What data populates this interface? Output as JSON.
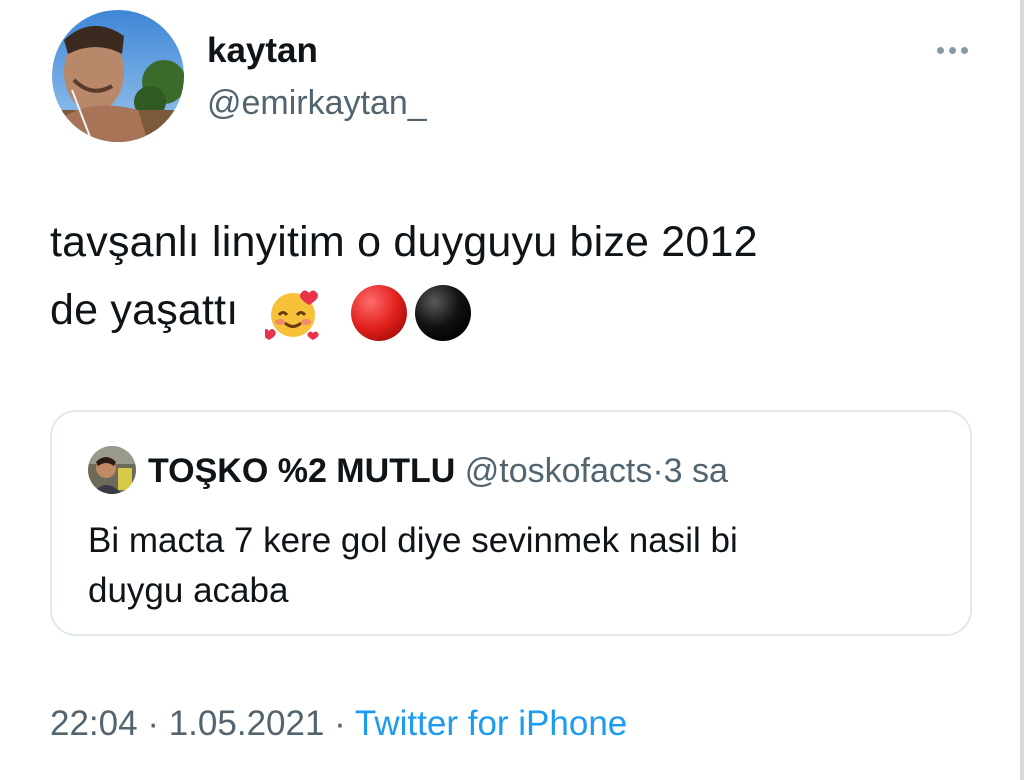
{
  "author": {
    "display_name": "kaytan",
    "username": "@emirkaytan_"
  },
  "tweet": {
    "text_line1": "tavşanlı linyitim o duyguyu bize 2012",
    "text_line2": "de yaşattı",
    "emojis": [
      "smiling-face-with-hearts",
      "red-circle",
      "black-circle"
    ]
  },
  "quoted_tweet": {
    "display_name": "TOŞKO %2 MUTLU",
    "username": "@toskofacts",
    "separator": "·",
    "time": "3 sa",
    "text_line1": "Bi macta 7 kere gol diye sevinmek nasil bi",
    "text_line2": "duygu acaba"
  },
  "meta": {
    "time": "22:04",
    "separator": "·",
    "date": "1.05.2021",
    "separator2": "·",
    "source": "Twitter for iPhone"
  },
  "colors": {
    "text": "#0f1419",
    "muted": "#536471",
    "link": "#1d9bf0",
    "border": "#e1e8ed"
  }
}
